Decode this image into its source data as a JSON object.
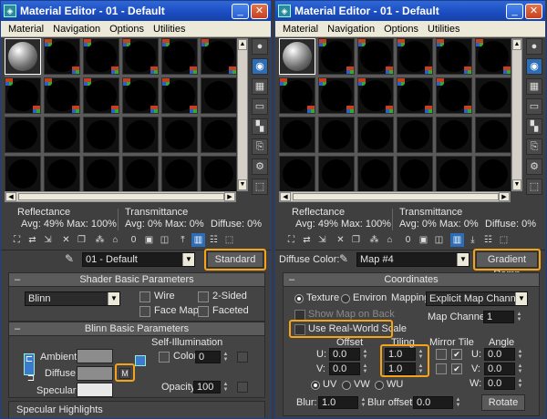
{
  "left": {
    "title": "Material Editor - 01 - Default",
    "menu": [
      "Material",
      "Navigation",
      "Options",
      "Utilities"
    ],
    "info": {
      "reflectance": "Reflectance",
      "reflectance_vals": "Avg:  49% Max: 100%",
      "transmittance": "Transmittance",
      "transmittance_vals": "Avg:   0% Max:   0%",
      "diffuse_vals": "Diffuse:  0%"
    },
    "name_field": "01 - Default",
    "type_button": "Standard",
    "shader": {
      "header": "Shader Basic Parameters",
      "shader_value": "Blinn",
      "wire": "Wire",
      "two_sided": "2-Sided",
      "face_map": "Face Map",
      "faceted": "Faceted"
    },
    "blinn": {
      "header": "Blinn Basic Parameters",
      "self_illum": "Self-Illumination",
      "color": "Color",
      "color_value": "0",
      "ambient": "Ambient:",
      "diffuse": "Diffuse:",
      "specular": "Specular:",
      "m_button": "M",
      "opacity": "Opacity:",
      "opacity_value": "100"
    },
    "specular_highlights": "Specular Highlights"
  },
  "right": {
    "title": "Material Editor - 01 - Default",
    "menu": [
      "Material",
      "Navigation",
      "Options",
      "Utilities"
    ],
    "info": {
      "reflectance": "Reflectance",
      "reflectance_vals": "Avg:  49% Max: 100%",
      "transmittance": "Transmittance",
      "transmittance_vals": "Avg:   0% Max:   0%",
      "diffuse_vals": "Diffuse:  0%"
    },
    "diffuse_color": "Diffuse Color:",
    "map_field": "Map #4",
    "type_button": "Gradient Ramp",
    "coordinates": {
      "header": "Coordinates",
      "texture": "Texture",
      "environ": "Environ",
      "mapping": "Mapping:",
      "mapping_value": "Explicit Map Channel",
      "show_map_on_back": "Show Map on Back",
      "map_channel": "Map Channel:",
      "map_channel_value": "1",
      "use_real_world_scale": "Use Real-World Scale",
      "offset": "Offset",
      "tiling": "Tiling",
      "mirror_tile": "Mirror Tile",
      "angle": "Angle",
      "u": "U:",
      "v": "V:",
      "w": "W:",
      "u_offset": "0.0",
      "v_offset": "0.0",
      "u_tiling": "1.0",
      "v_tiling": "1.0",
      "u_angle": "0.0",
      "v_angle": "0.0",
      "w_angle": "0.0",
      "uv": "UV",
      "vw": "VW",
      "wu": "WU",
      "blur": "Blur:",
      "blur_value": "1.0",
      "blur_offset": "Blur offset:",
      "blur_offset_value": "0.0",
      "rotate": "Rotate"
    }
  },
  "colors": {
    "highlight": "#f7a318",
    "title_bar": "#1b4cc0",
    "panel": "#3f3f3f",
    "ambient_swatch": "#8c8c8c",
    "diffuse_swatch": "#8c8c8c",
    "specular_swatch": "#e8e8e8"
  }
}
